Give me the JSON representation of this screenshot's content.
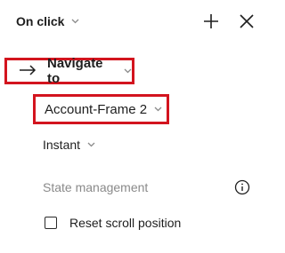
{
  "header": {
    "trigger_label": "On click",
    "trigger_icon": "chevron-down-icon",
    "add_icon": "plus-icon",
    "close_icon": "close-icon"
  },
  "action": {
    "icon": "arrow-right-icon",
    "label": "Navigate to"
  },
  "destination": {
    "value": "Account-Frame 2"
  },
  "animation": {
    "value": "Instant"
  },
  "state_management": {
    "label": "State management",
    "info_icon": "info-icon"
  },
  "reset_scroll": {
    "label": "Reset scroll position",
    "checked": false
  },
  "colors": {
    "highlight": "#d3141e",
    "muted_text": "#8a8a8a",
    "text": "#1e1e1e"
  }
}
